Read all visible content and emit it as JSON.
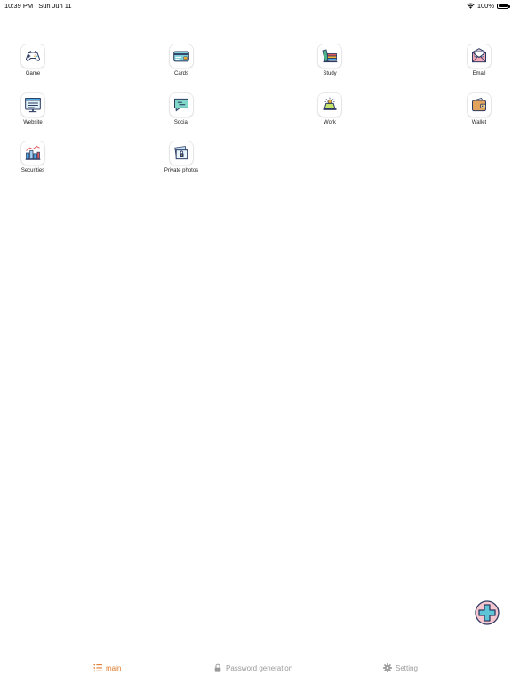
{
  "status_bar": {
    "time": "10:39 PM",
    "date": "Sun Jun 11",
    "battery": "100%",
    "battery_level": 1.0
  },
  "apps": [
    {
      "label": "Game",
      "icon": "gamepad-icon"
    },
    {
      "label": "Cards",
      "icon": "card-icon"
    },
    {
      "label": "Study",
      "icon": "books-icon"
    },
    {
      "label": "Email",
      "icon": "envelope-icon"
    },
    {
      "label": "Website",
      "icon": "browser-icon"
    },
    {
      "label": "Social",
      "icon": "chat-icon"
    },
    {
      "label": "Work",
      "icon": "desk-lamp-icon"
    },
    {
      "label": "Wallet",
      "icon": "wallet-icon"
    },
    {
      "label": "Securities",
      "icon": "stock-chart-icon"
    },
    {
      "label": "Private photos",
      "icon": "photo-lock-icon"
    }
  ],
  "fab": {
    "icon": "plus-icon"
  },
  "tabs": [
    {
      "label": "main",
      "icon": "list-icon",
      "active": true
    },
    {
      "label": "Password generation",
      "icon": "lock-icon",
      "active": false
    },
    {
      "label": "Setting",
      "icon": "gear-icon",
      "active": false
    }
  ],
  "colors": {
    "accent": "#e07a2c",
    "inactive": "#9a9a9a",
    "fab_fill": "#5ec5d6"
  }
}
